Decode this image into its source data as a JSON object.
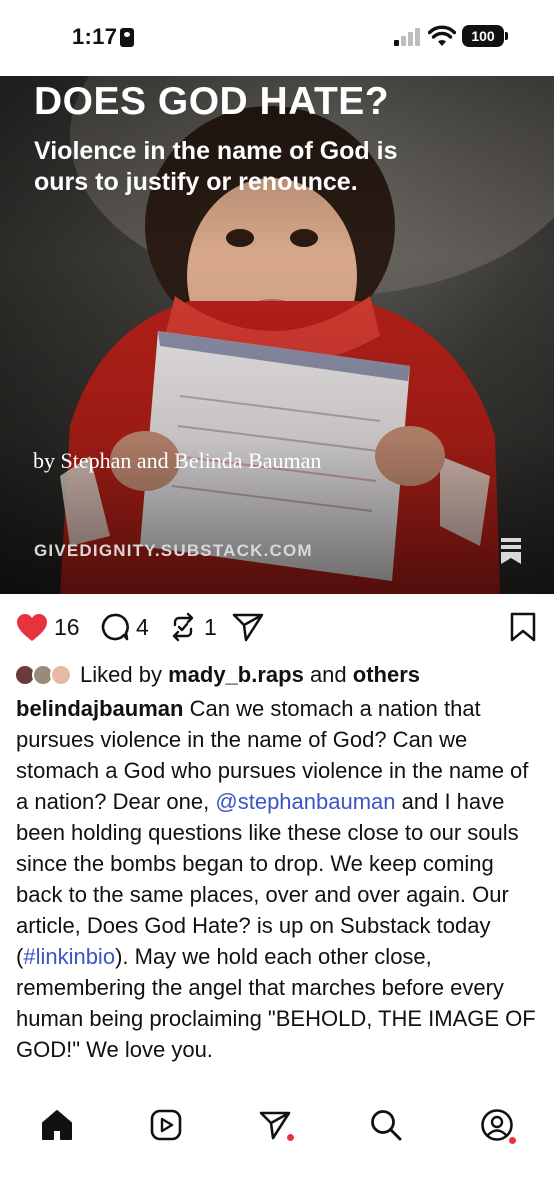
{
  "status_bar": {
    "time": "1:17",
    "battery": "100"
  },
  "post": {
    "hero": {
      "title": "DOES GOD HATE?",
      "subtitle": "Violence in the name of God is ours to justify or renounce.",
      "byline": "by Stephan and Belinda Bauman",
      "domain": "GIVEDIGNITY.SUBSTACK.COM"
    },
    "actions": {
      "likes_count": "16",
      "comments_count": "4",
      "reposts_count": "1"
    },
    "liked_by": {
      "prefix": "Liked by",
      "user": "mady_b.raps",
      "joiner": "and",
      "others": "others"
    },
    "caption": {
      "username": "belindajbauman",
      "part1": "Can we stomach a nation that pursues violence in the name of God? Can we stomach a God who pursues violence in the name of a nation? Dear one,",
      "mention": "@stephanbauman",
      "part2": "and I have been holding questions like these close to our souls since the bombs began to drop. We keep coming back to the same places, over and over again. Our article, Does God Hate? is up on Substack today (",
      "hashtag": "#linkinbio",
      "part3": "). May we hold each other close, remembering the angel that marches before every human being proclaiming \"BEHOLD, THE IMAGE OF GOD!\" We love you."
    }
  },
  "colors": {
    "like_red": "#e8323d",
    "link_blue": "#3b55c6"
  },
  "icons": [
    "home-icon",
    "reels-icon",
    "send-icon",
    "search-icon",
    "profile-icon",
    "heart-icon",
    "comment-icon",
    "repost-icon",
    "share-icon",
    "bookmark-icon"
  ]
}
